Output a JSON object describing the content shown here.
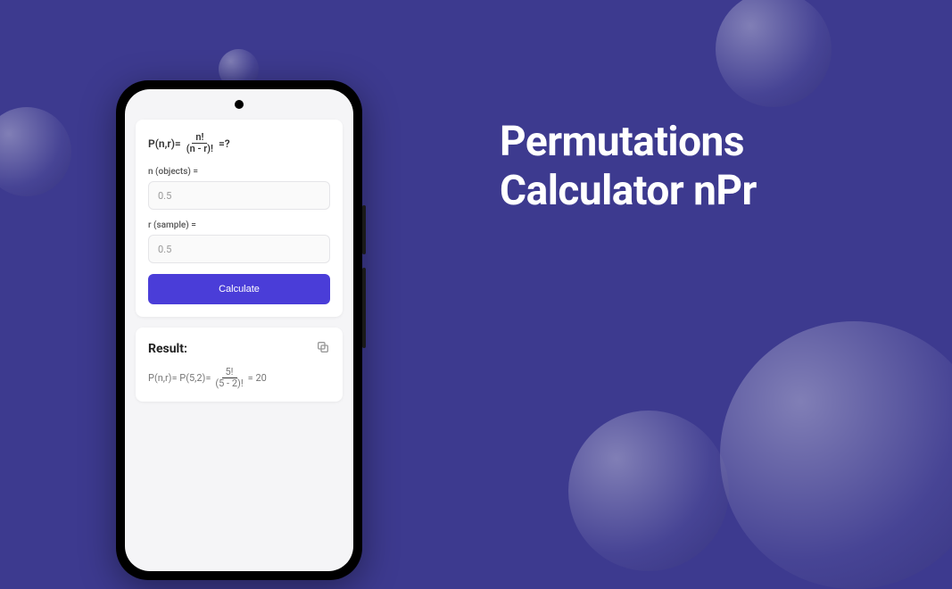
{
  "title_line1": "Permutations",
  "title_line2": "Calculator nPr",
  "formula": {
    "lhs": "P(n,r)=",
    "frac_top": "n!",
    "frac_bot": "(n - r)!",
    "suffix": "=?"
  },
  "fields": {
    "n_label": "n (objects) =",
    "n_placeholder": "0.5",
    "r_label": "r (sample) =",
    "r_placeholder": "0.5"
  },
  "calculate_label": "Calculate",
  "result": {
    "heading": "Result:",
    "prefix": "P(n,r)= P(5,2)=",
    "frac_top": "5!",
    "frac_bot": "(5 - 2)!",
    "equals_value": "= 20"
  },
  "colors": {
    "background": "#3d3a8f",
    "accent": "#4a3dd8"
  }
}
